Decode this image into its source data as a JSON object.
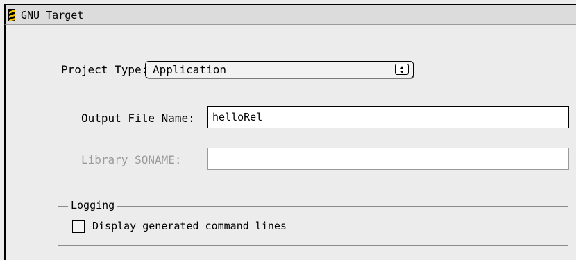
{
  "window": {
    "title": "GNU Target"
  },
  "project_type": {
    "label": "Project Type:",
    "selected": "Application"
  },
  "output_file": {
    "label": "Output File Name:",
    "value": "helloRel"
  },
  "library_soname": {
    "label": "Library SONAME:",
    "value": ""
  },
  "logging": {
    "title": "Logging",
    "checkbox_label": "Display generated command lines",
    "checked": false
  },
  "colors": {
    "disabled_text": "#9a9a9a",
    "panel": "#ececec"
  }
}
